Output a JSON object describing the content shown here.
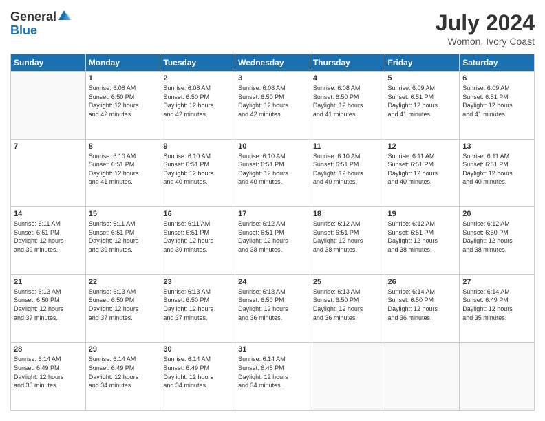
{
  "header": {
    "logo_general": "General",
    "logo_blue": "Blue",
    "month_year": "July 2024",
    "location": "Womon, Ivory Coast"
  },
  "weekdays": [
    "Sunday",
    "Monday",
    "Tuesday",
    "Wednesday",
    "Thursday",
    "Friday",
    "Saturday"
  ],
  "weeks": [
    [
      {
        "day": "",
        "info": ""
      },
      {
        "day": "1",
        "info": "Sunrise: 6:08 AM\nSunset: 6:50 PM\nDaylight: 12 hours\nand 42 minutes."
      },
      {
        "day": "2",
        "info": "Sunrise: 6:08 AM\nSunset: 6:50 PM\nDaylight: 12 hours\nand 42 minutes."
      },
      {
        "day": "3",
        "info": "Sunrise: 6:08 AM\nSunset: 6:50 PM\nDaylight: 12 hours\nand 42 minutes."
      },
      {
        "day": "4",
        "info": "Sunrise: 6:08 AM\nSunset: 6:50 PM\nDaylight: 12 hours\nand 41 minutes."
      },
      {
        "day": "5",
        "info": "Sunrise: 6:09 AM\nSunset: 6:51 PM\nDaylight: 12 hours\nand 41 minutes."
      },
      {
        "day": "6",
        "info": "Sunrise: 6:09 AM\nSunset: 6:51 PM\nDaylight: 12 hours\nand 41 minutes."
      }
    ],
    [
      {
        "day": "7",
        "info": ""
      },
      {
        "day": "8",
        "info": "Sunrise: 6:10 AM\nSunset: 6:51 PM\nDaylight: 12 hours\nand 41 minutes."
      },
      {
        "day": "9",
        "info": "Sunrise: 6:10 AM\nSunset: 6:51 PM\nDaylight: 12 hours\nand 40 minutes."
      },
      {
        "day": "10",
        "info": "Sunrise: 6:10 AM\nSunset: 6:51 PM\nDaylight: 12 hours\nand 40 minutes."
      },
      {
        "day": "11",
        "info": "Sunrise: 6:10 AM\nSunset: 6:51 PM\nDaylight: 12 hours\nand 40 minutes."
      },
      {
        "day": "12",
        "info": "Sunrise: 6:11 AM\nSunset: 6:51 PM\nDaylight: 12 hours\nand 40 minutes."
      },
      {
        "day": "13",
        "info": "Sunrise: 6:11 AM\nSunset: 6:51 PM\nDaylight: 12 hours\nand 40 minutes."
      }
    ],
    [
      {
        "day": "14",
        "info": "Sunrise: 6:11 AM\nSunset: 6:51 PM\nDaylight: 12 hours\nand 39 minutes."
      },
      {
        "day": "15",
        "info": "Sunrise: 6:11 AM\nSunset: 6:51 PM\nDaylight: 12 hours\nand 39 minutes."
      },
      {
        "day": "16",
        "info": "Sunrise: 6:11 AM\nSunset: 6:51 PM\nDaylight: 12 hours\nand 39 minutes."
      },
      {
        "day": "17",
        "info": "Sunrise: 6:12 AM\nSunset: 6:51 PM\nDaylight: 12 hours\nand 38 minutes."
      },
      {
        "day": "18",
        "info": "Sunrise: 6:12 AM\nSunset: 6:51 PM\nDaylight: 12 hours\nand 38 minutes."
      },
      {
        "day": "19",
        "info": "Sunrise: 6:12 AM\nSunset: 6:51 PM\nDaylight: 12 hours\nand 38 minutes."
      },
      {
        "day": "20",
        "info": "Sunrise: 6:12 AM\nSunset: 6:50 PM\nDaylight: 12 hours\nand 38 minutes."
      }
    ],
    [
      {
        "day": "21",
        "info": "Sunrise: 6:13 AM\nSunset: 6:50 PM\nDaylight: 12 hours\nand 37 minutes."
      },
      {
        "day": "22",
        "info": "Sunrise: 6:13 AM\nSunset: 6:50 PM\nDaylight: 12 hours\nand 37 minutes."
      },
      {
        "day": "23",
        "info": "Sunrise: 6:13 AM\nSunset: 6:50 PM\nDaylight: 12 hours\nand 37 minutes."
      },
      {
        "day": "24",
        "info": "Sunrise: 6:13 AM\nSunset: 6:50 PM\nDaylight: 12 hours\nand 36 minutes."
      },
      {
        "day": "25",
        "info": "Sunrise: 6:13 AM\nSunset: 6:50 PM\nDaylight: 12 hours\nand 36 minutes."
      },
      {
        "day": "26",
        "info": "Sunrise: 6:14 AM\nSunset: 6:50 PM\nDaylight: 12 hours\nand 36 minutes."
      },
      {
        "day": "27",
        "info": "Sunrise: 6:14 AM\nSunset: 6:49 PM\nDaylight: 12 hours\nand 35 minutes."
      }
    ],
    [
      {
        "day": "28",
        "info": "Sunrise: 6:14 AM\nSunset: 6:49 PM\nDaylight: 12 hours\nand 35 minutes."
      },
      {
        "day": "29",
        "info": "Sunrise: 6:14 AM\nSunset: 6:49 PM\nDaylight: 12 hours\nand 34 minutes."
      },
      {
        "day": "30",
        "info": "Sunrise: 6:14 AM\nSunset: 6:49 PM\nDaylight: 12 hours\nand 34 minutes."
      },
      {
        "day": "31",
        "info": "Sunrise: 6:14 AM\nSunset: 6:48 PM\nDaylight: 12 hours\nand 34 minutes."
      },
      {
        "day": "",
        "info": ""
      },
      {
        "day": "",
        "info": ""
      },
      {
        "day": "",
        "info": ""
      }
    ]
  ]
}
